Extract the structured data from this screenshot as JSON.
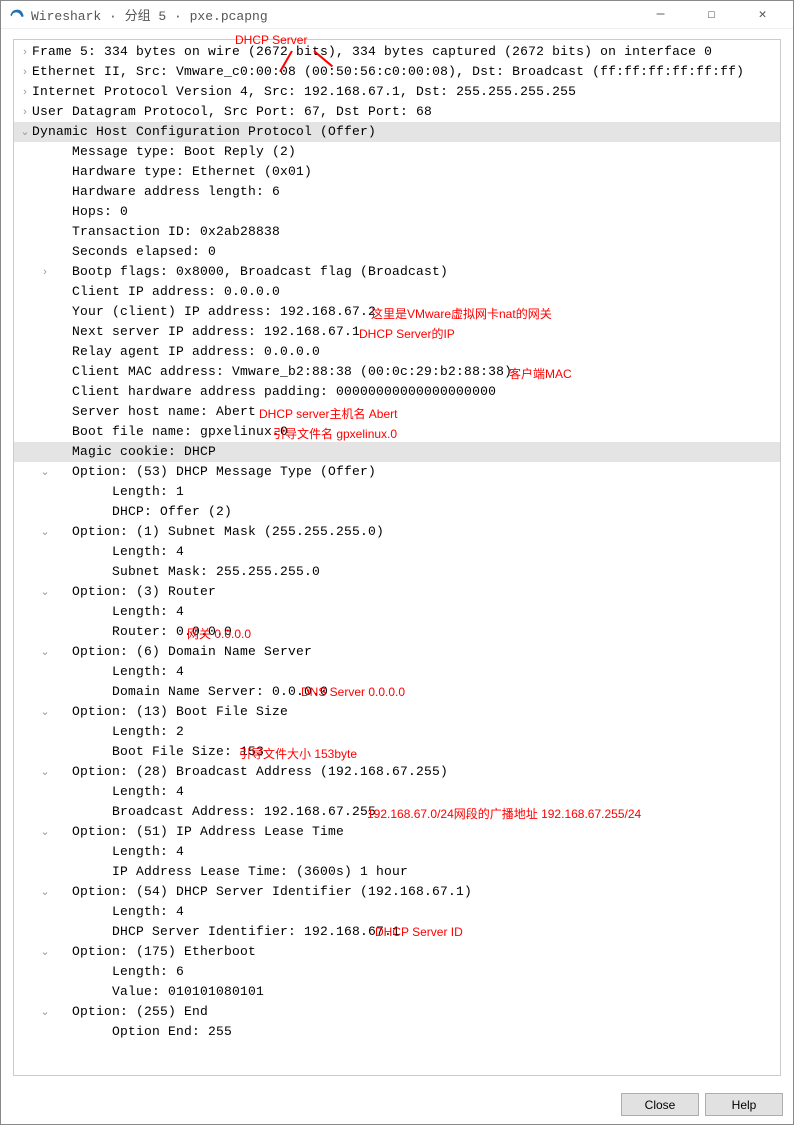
{
  "title": "Wireshark · 分组 5 · pxe.pcapng",
  "anno_top": "DHCP Server",
  "annotations": {
    "a1": "这里是VMware虚拟网卡nat的网关",
    "a2": "DHCP Server的IP",
    "a3": "客户端MAC",
    "a4": "DHCP server主机名 Abert",
    "a5": "引导文件名 gpxelinux.0",
    "a6": "网关 0.0.0.0",
    "a7": "DNS Server 0.0.0.0",
    "a8": "引导文件大小 153byte",
    "a9": "192.168.67.0/24网段的广播地址 192.168.67.255/24",
    "a10": "DHCP Server ID"
  },
  "rows": [
    {
      "ind": 0,
      "arr": ">",
      "txt": "Frame 5: 334 bytes on wire (2672 bits), 334 bytes captured (2672 bits) on interface 0"
    },
    {
      "ind": 0,
      "arr": ">",
      "txt": "Ethernet II, Src: Vmware_c0:00:08 (00:50:56:c0:00:08), Dst: Broadcast (ff:ff:ff:ff:ff:ff)"
    },
    {
      "ind": 0,
      "arr": ">",
      "txt": "Internet Protocol Version 4, Src: 192.168.67.1, Dst: 255.255.255.255"
    },
    {
      "ind": 0,
      "arr": ">",
      "txt": "User Datagram Protocol, Src Port: 67, Dst Port: 68"
    },
    {
      "ind": 0,
      "arr": "v",
      "txt": "Dynamic Host Configuration Protocol (Offer)",
      "hl": true
    },
    {
      "ind": 1,
      "arr": "",
      "txt": "Message type: Boot Reply (2)"
    },
    {
      "ind": 1,
      "arr": "",
      "txt": "Hardware type: Ethernet (0x01)"
    },
    {
      "ind": 1,
      "arr": "",
      "txt": "Hardware address length: 6"
    },
    {
      "ind": 1,
      "arr": "",
      "txt": "Hops: 0"
    },
    {
      "ind": 1,
      "arr": "",
      "txt": "Transaction ID: 0x2ab28838"
    },
    {
      "ind": 1,
      "arr": "",
      "txt": "Seconds elapsed: 0"
    },
    {
      "ind": 1,
      "arr": ">",
      "txt": "Bootp flags: 0x8000, Broadcast flag (Broadcast)"
    },
    {
      "ind": 1,
      "arr": "",
      "txt": "Client IP address: 0.0.0.0"
    },
    {
      "ind": 1,
      "arr": "",
      "txt": "Your (client) IP address: 192.168.67.2"
    },
    {
      "ind": 1,
      "arr": "",
      "txt": "Next server IP address: 192.168.67.1"
    },
    {
      "ind": 1,
      "arr": "",
      "txt": "Relay agent IP address: 0.0.0.0"
    },
    {
      "ind": 1,
      "arr": "",
      "txt": "Client MAC address: Vmware_b2:88:38 (00:0c:29:b2:88:38)"
    },
    {
      "ind": 1,
      "arr": "",
      "txt": "Client hardware address padding: 00000000000000000000"
    },
    {
      "ind": 1,
      "arr": "",
      "txt": "Server host name: Abert"
    },
    {
      "ind": 1,
      "arr": "",
      "txt": "Boot file name: gpxelinux.0"
    },
    {
      "ind": 1,
      "arr": "",
      "txt": "Magic cookie: DHCP",
      "hl": true
    },
    {
      "ind": 1,
      "arr": "v",
      "txt": "Option: (53) DHCP Message Type (Offer)"
    },
    {
      "ind": 2,
      "arr": "",
      "txt": "Length: 1"
    },
    {
      "ind": 2,
      "arr": "",
      "txt": "DHCP: Offer (2)"
    },
    {
      "ind": 1,
      "arr": "v",
      "txt": "Option: (1) Subnet Mask (255.255.255.0)"
    },
    {
      "ind": 2,
      "arr": "",
      "txt": "Length: 4"
    },
    {
      "ind": 2,
      "arr": "",
      "txt": "Subnet Mask: 255.255.255.0"
    },
    {
      "ind": 1,
      "arr": "v",
      "txt": "Option: (3) Router"
    },
    {
      "ind": 2,
      "arr": "",
      "txt": "Length: 4"
    },
    {
      "ind": 2,
      "arr": "",
      "txt": "Router: 0.0.0.0"
    },
    {
      "ind": 1,
      "arr": "v",
      "txt": "Option: (6) Domain Name Server"
    },
    {
      "ind": 2,
      "arr": "",
      "txt": "Length: 4"
    },
    {
      "ind": 2,
      "arr": "",
      "txt": "Domain Name Server: 0.0.0.0"
    },
    {
      "ind": 1,
      "arr": "v",
      "txt": "Option: (13) Boot File Size"
    },
    {
      "ind": 2,
      "arr": "",
      "txt": "Length: 2"
    },
    {
      "ind": 2,
      "arr": "",
      "txt": "Boot File Size: 153"
    },
    {
      "ind": 1,
      "arr": "v",
      "txt": "Option: (28) Broadcast Address (192.168.67.255)"
    },
    {
      "ind": 2,
      "arr": "",
      "txt": "Length: 4"
    },
    {
      "ind": 2,
      "arr": "",
      "txt": "Broadcast Address: 192.168.67.255"
    },
    {
      "ind": 1,
      "arr": "v",
      "txt": "Option: (51) IP Address Lease Time"
    },
    {
      "ind": 2,
      "arr": "",
      "txt": "Length: 4"
    },
    {
      "ind": 2,
      "arr": "",
      "txt": "IP Address Lease Time: (3600s) 1 hour"
    },
    {
      "ind": 1,
      "arr": "v",
      "txt": "Option: (54) DHCP Server Identifier (192.168.67.1)"
    },
    {
      "ind": 2,
      "arr": "",
      "txt": "Length: 4"
    },
    {
      "ind": 2,
      "arr": "",
      "txt": "DHCP Server Identifier: 192.168.67.1"
    },
    {
      "ind": 1,
      "arr": "v",
      "txt": "Option: (175) Etherboot"
    },
    {
      "ind": 2,
      "arr": "",
      "txt": "Length: 6"
    },
    {
      "ind": 2,
      "arr": "",
      "txt": "Value: 010101080101"
    },
    {
      "ind": 1,
      "arr": "v",
      "txt": "Option: (255) End"
    },
    {
      "ind": 2,
      "arr": "",
      "txt": "Option End: 255"
    }
  ],
  "buttons": {
    "close": "Close",
    "help": "Help"
  }
}
